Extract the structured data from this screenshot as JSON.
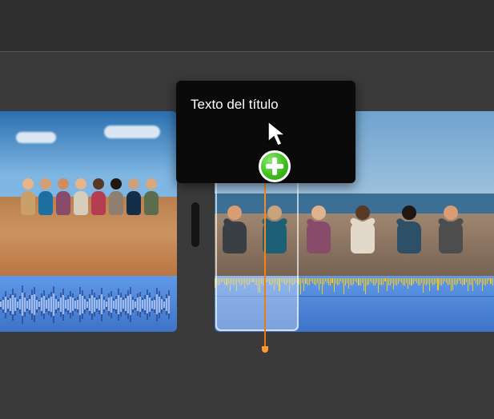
{
  "title_drag": {
    "label": "Texto del título"
  },
  "cursor": {
    "name": "drag-copy-cursor",
    "badge": "add-plus"
  },
  "timeline": {
    "playhead_clip_index": 1
  },
  "colors": {
    "playhead": "#ff9a2e",
    "audio_track": "#3e74c8",
    "plus_badge": "#41bf1f"
  }
}
